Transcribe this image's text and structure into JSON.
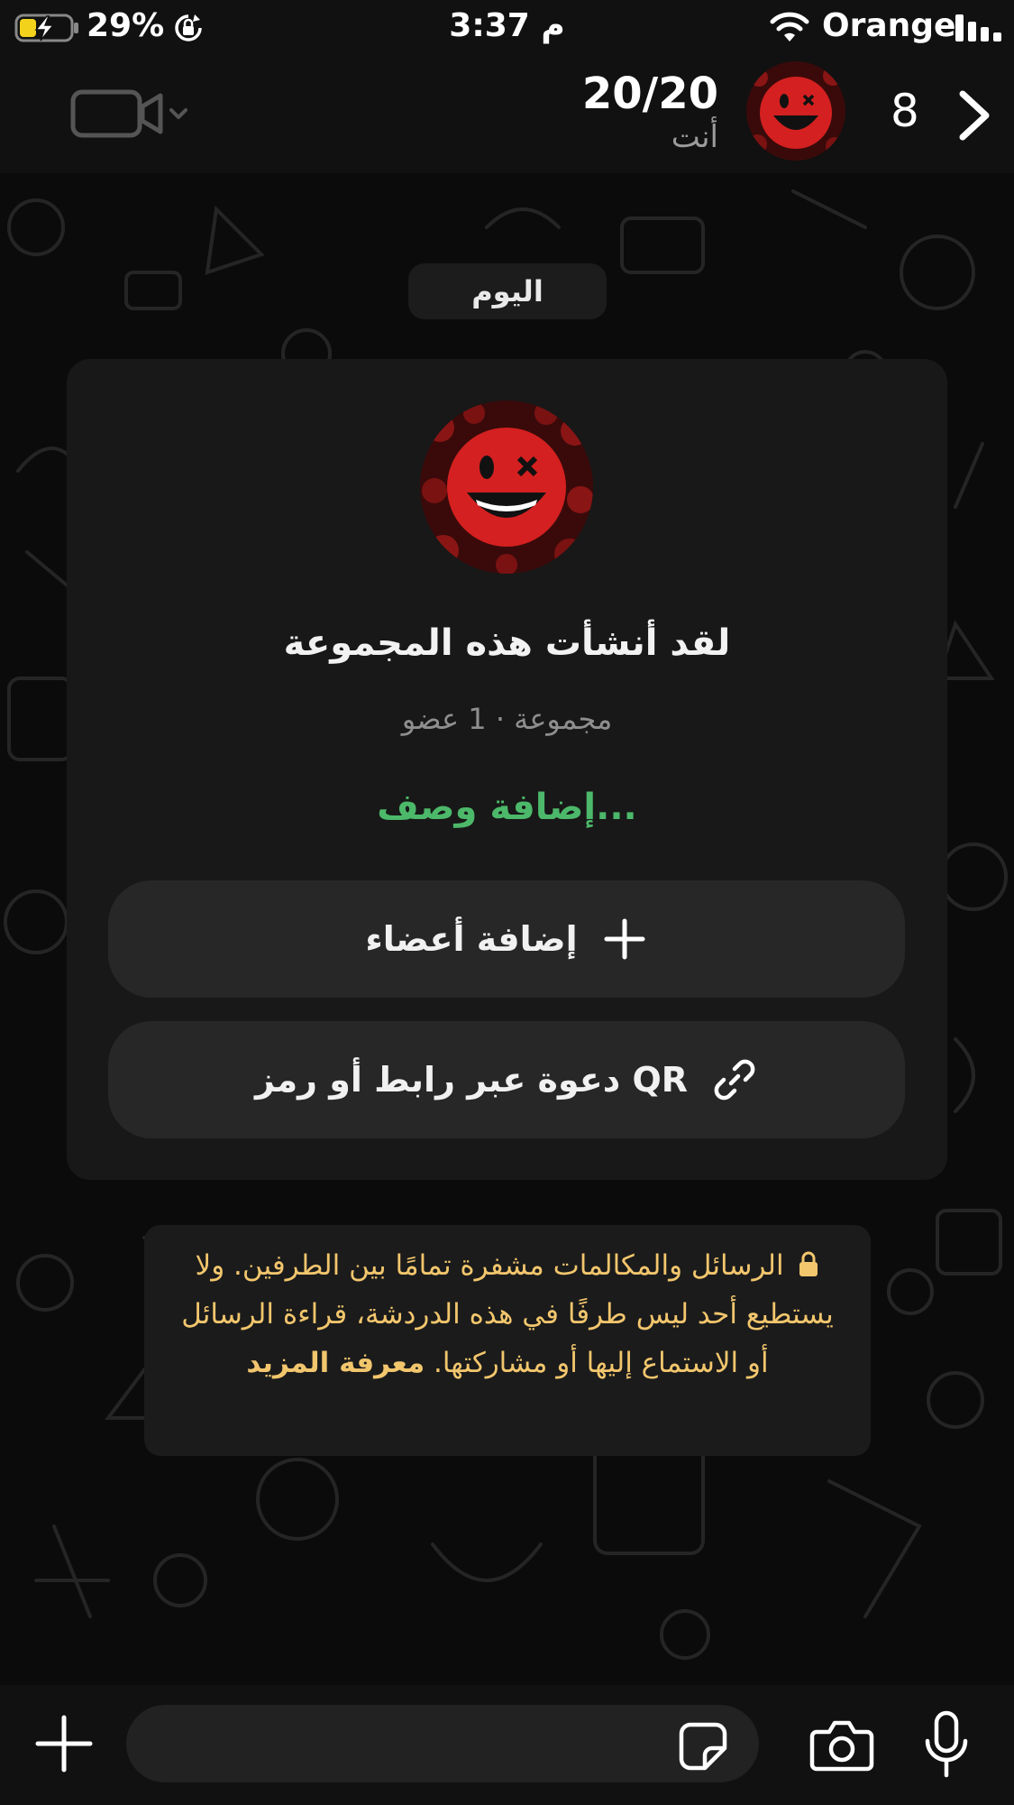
{
  "status_bar": {
    "battery_percent": "29%",
    "time": "3:37 م",
    "carrier": "Orange"
  },
  "header": {
    "title": "20/20",
    "subtitle": "أنت",
    "count": "8",
    "icons": [
      "video-camera-icon",
      "chevron-down-icon",
      "avatar",
      "chevron-right-icon"
    ]
  },
  "chat": {
    "date_label": "اليوم",
    "card": {
      "title": "لقد أنشأت هذه المجموعة",
      "meta": "مجموعة · 1 عضو",
      "description_prompt": "إضافة وصف...",
      "add_members_label": "إضافة أعضاء",
      "invite_label": "دعوة عبر رابط أو رمز QR"
    },
    "encryption_notice": {
      "text": "الرسائل والمكالمات مشفرة تمامًا بين الطرفين. ولا يستطيع أحد ليس طرفًا في هذه الدردشة، قراءة الرسائل أو الاستماع إليها أو مشاركتها.",
      "learn_more": "معرفة المزيد"
    }
  },
  "input_bar": {
    "placeholder": "",
    "icons": [
      "plus-icon",
      "sticker-icon",
      "camera-icon",
      "microphone-icon"
    ]
  },
  "colors": {
    "accent_green": "#4cb86a",
    "notice_yellow": "#f2c66d",
    "background": "#0b0b0b",
    "bubble": "#181818",
    "avatar_red": "#d42020"
  }
}
